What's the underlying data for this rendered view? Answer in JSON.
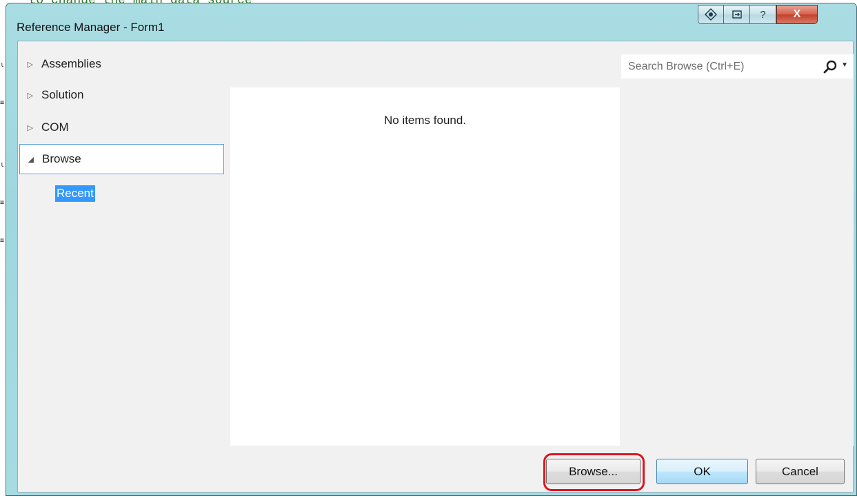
{
  "background": {
    "code_line": "  to change the main data source"
  },
  "window": {
    "title": "Reference Manager - Form1",
    "controls": {
      "nav_glyph": "◇",
      "restore_glyph": "⊡",
      "help_glyph": "?",
      "close_glyph": "X"
    }
  },
  "nav": {
    "items": [
      {
        "label": "Assemblies",
        "expander": "▷"
      },
      {
        "label": "Solution",
        "expander": "▷"
      },
      {
        "label": "COM",
        "expander": "▷"
      },
      {
        "label": "Browse",
        "expander": "◢"
      }
    ],
    "sub_item": "Recent"
  },
  "results": {
    "empty_message": "No items found."
  },
  "search": {
    "placeholder": "Search Browse (Ctrl+E)",
    "value": ""
  },
  "footer": {
    "browse_label": "Browse...",
    "ok_label": "OK",
    "cancel_label": "Cancel"
  },
  "colors": {
    "accent": "#3399ff",
    "highlight": "#e0141e",
    "window_frame": "#a9dde3"
  }
}
